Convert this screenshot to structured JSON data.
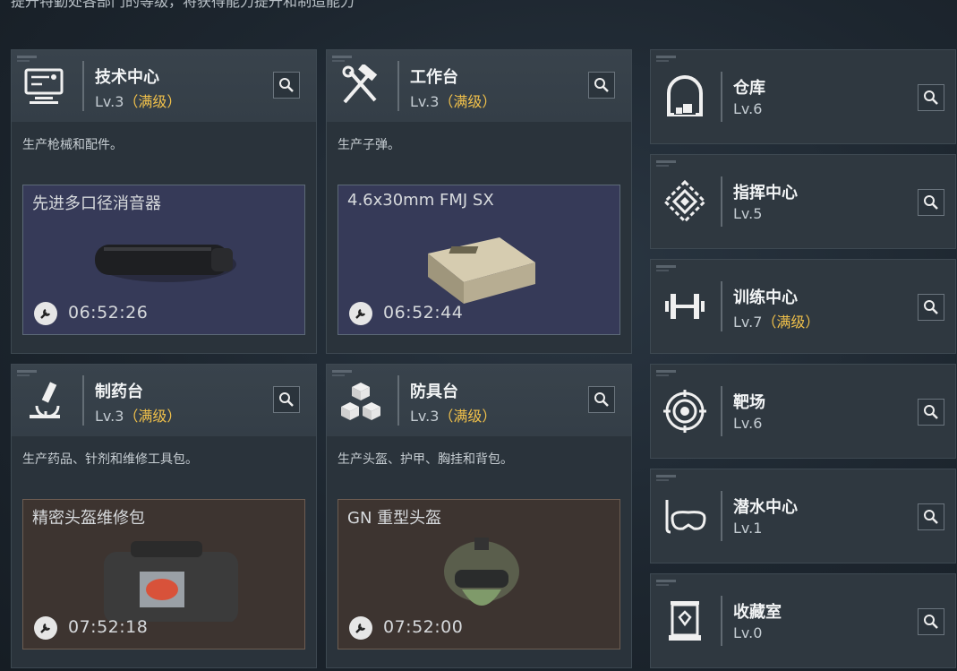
{
  "header": {
    "subtitle": "提升特勤处各部门的等级，将获得能力提升和制造能力"
  },
  "facilities": [
    {
      "name": "技术中心",
      "level": "Lv.3",
      "max": "（满级）",
      "desc": "生产枪械和配件。",
      "production": {
        "item": "先进多口径消音器",
        "time": "06:52:26"
      }
    },
    {
      "name": "工作台",
      "level": "Lv.3",
      "max": "（满级）",
      "desc": "生产子弹。",
      "production": {
        "item": "4.6x30mm FMJ SX",
        "time": "06:52:44"
      }
    },
    {
      "name": "制药台",
      "level": "Lv.3",
      "max": "（满级）",
      "desc": "生产药品、针剂和维修工具包。",
      "production": {
        "item": "精密头盔维修包",
        "time": "07:52:18"
      }
    },
    {
      "name": "防具台",
      "level": "Lv.3",
      "max": "（满级）",
      "desc": "生产头盔、护甲、胸挂和背包。",
      "production": {
        "item": "GN 重型头盔",
        "time": "07:52:00"
      }
    }
  ],
  "side": [
    {
      "name": "仓库",
      "level": "Lv.6",
      "max": ""
    },
    {
      "name": "指挥中心",
      "level": "Lv.5",
      "max": ""
    },
    {
      "name": "训练中心",
      "level": "Lv.7",
      "max": "（满级）"
    },
    {
      "name": "靶场",
      "level": "Lv.6",
      "max": ""
    },
    {
      "name": "潜水中心",
      "level": "Lv.1",
      "max": ""
    },
    {
      "name": "收藏室",
      "level": "Lv.0",
      "max": ""
    }
  ],
  "colors": {
    "accent_max": "#f0c04a",
    "panel": "#2a333b",
    "prod_blue": "#363a58",
    "prod_brown": "#3d3430"
  },
  "icons": [
    "computer-icon",
    "hammer-wrench-icon",
    "microscope-icon",
    "cubes-icon",
    "vault-icon",
    "emblem-icon",
    "dumbbell-icon",
    "target-icon",
    "diving-mask-icon",
    "display-case-icon",
    "search-icon",
    "wrench-icon"
  ]
}
